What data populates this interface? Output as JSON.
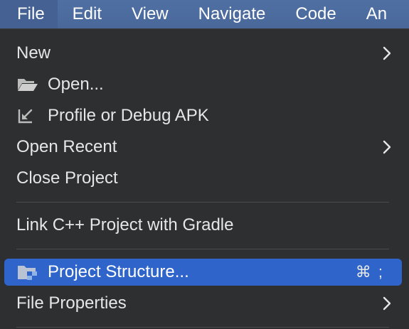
{
  "menubar": {
    "items": [
      {
        "label": "File"
      },
      {
        "label": "Edit"
      },
      {
        "label": "View"
      },
      {
        "label": "Navigate"
      },
      {
        "label": "Code"
      },
      {
        "label": "An"
      }
    ]
  },
  "file_menu": {
    "new_label": "New",
    "open_label": "Open...",
    "profile_label": "Profile or Debug APK",
    "open_recent_label": "Open Recent",
    "close_project_label": "Close Project",
    "link_cpp_label": "Link C++ Project with Gradle",
    "project_structure_label": "Project Structure...",
    "project_structure_shortcut": "⌘ ;",
    "file_properties_label": "File Properties"
  },
  "colors": {
    "menubar_bg": "#4a689a",
    "dropdown_bg": "#2e2f31",
    "selection": "#2f65ca",
    "text": "#e6e6e6"
  }
}
